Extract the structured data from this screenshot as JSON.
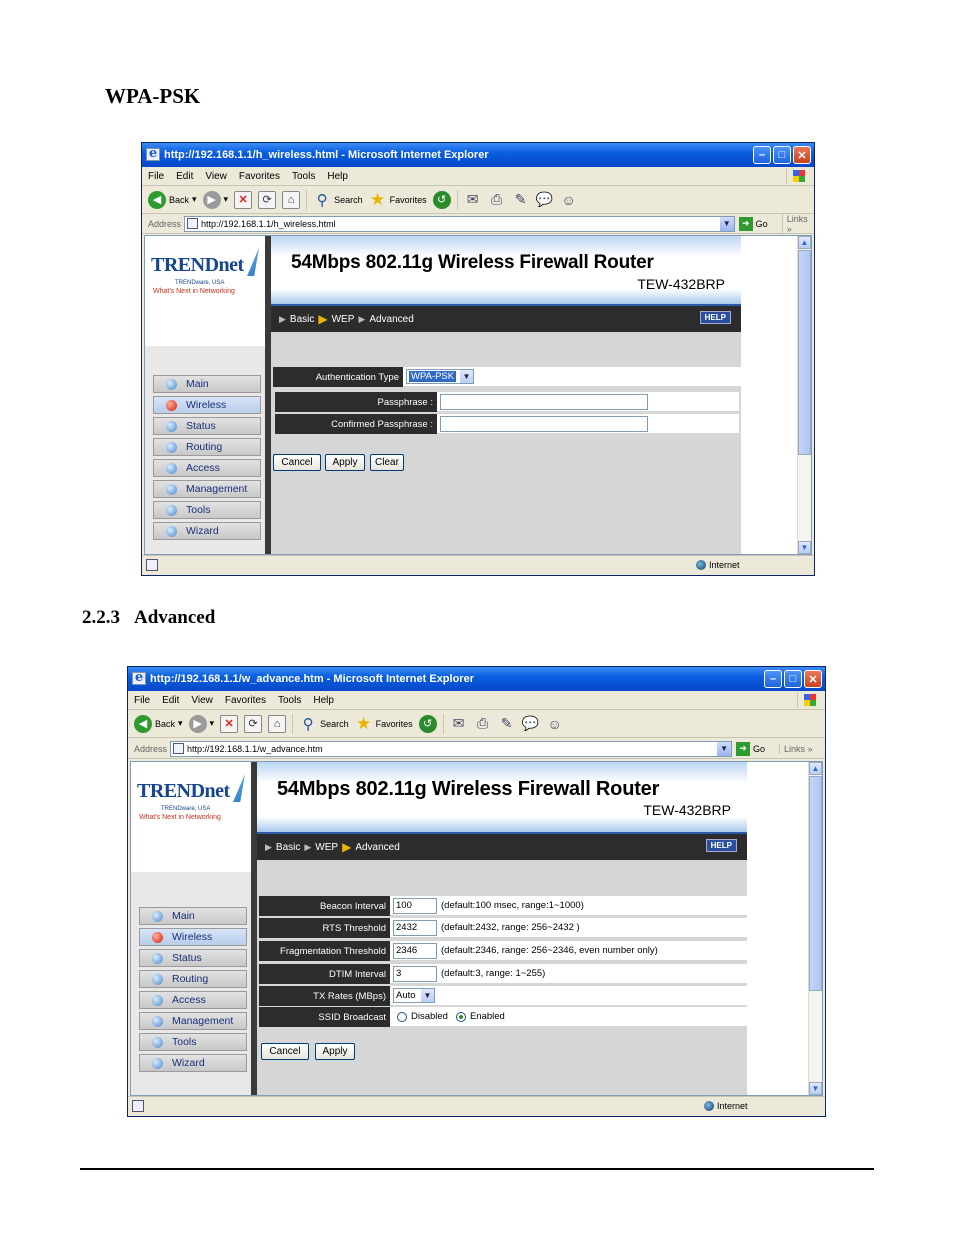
{
  "doc": {
    "heading_wpa": "WPA-PSK",
    "section_number": "2.2.3",
    "section_title": "Advanced"
  },
  "browser_common": {
    "menu": [
      "File",
      "Edit",
      "View",
      "Favorites",
      "Tools",
      "Help"
    ],
    "back": "Back",
    "search": "Search",
    "favorites": "Favorites",
    "address_label": "Address",
    "go": "Go",
    "links": "Links",
    "status_zone": "Internet"
  },
  "router_common": {
    "brand": "TRENDnet",
    "tagline1": "TRENDware, USA",
    "tagline2": "What's Next in Networking",
    "banner_title": "54Mbps 802.11g Wireless Firewall Router",
    "banner_model": "TEW-432BRP",
    "crumbs": [
      "Basic",
      "WEP",
      "Advanced"
    ],
    "help": "HELP",
    "nav": [
      "Main",
      "Wireless",
      "Status",
      "Routing",
      "Access",
      "Management",
      "Tools",
      "Wizard"
    ]
  },
  "win1": {
    "title": "http://192.168.1.1/h_wireless.html - Microsoft Internet Explorer",
    "url": "http://192.168.1.1/h_wireless.html",
    "auth_label": "Authentication Type",
    "auth_value": "WPA-PSK",
    "passphrase_label": "Passphrase :",
    "confirm_label": "Confirmed Passphrase :",
    "buttons": [
      "Cancel",
      "Apply",
      "Clear"
    ]
  },
  "win2": {
    "title": "http://192.168.1.1/w_advance.htm - Microsoft Internet Explorer",
    "url": "http://192.168.1.1/w_advance.htm",
    "rows": [
      {
        "label": "Beacon Interval",
        "value": "100",
        "hint": "(default:100 msec, range:1~1000)"
      },
      {
        "label": "RTS Threshold",
        "value": "2432",
        "hint": "(default:2432, range: 256~2432 )"
      },
      {
        "label": "Fragmentation Threshold",
        "value": "2346",
        "hint": "(default:2346, range: 256~2346, even number only)"
      },
      {
        "label": "DTIM Interval",
        "value": "3",
        "hint": "(default:3, range: 1~255)"
      }
    ],
    "tx_label": "TX Rates (MBps)",
    "tx_value": "Auto",
    "ssid_label": "SSID Broadcast",
    "ssid_disabled": "Disabled",
    "ssid_enabled": "Enabled",
    "buttons": [
      "Cancel",
      "Apply"
    ]
  }
}
